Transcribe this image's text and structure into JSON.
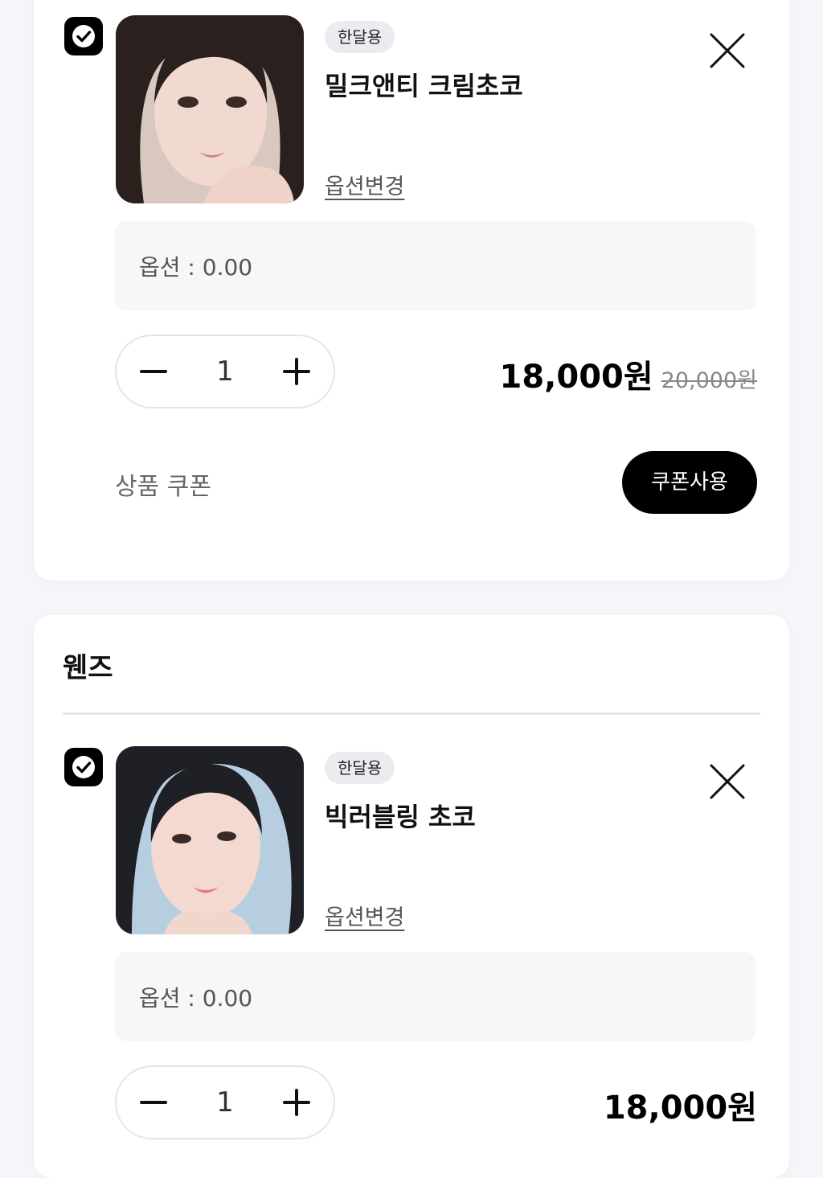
{
  "items": [
    {
      "badge": "한달용",
      "name": "밀크앤티 크림초코",
      "option_change": "옵션변경",
      "option_text": "옵션 : 0.00",
      "quantity": "1",
      "price": "18,000원",
      "original_price": "20,000원",
      "coupon_label": "상품 쿠폰",
      "coupon_button": "쿠폰사용",
      "checked": true
    },
    {
      "badge": "한달용",
      "name": "빅러블링 초코",
      "option_change": "옵션변경",
      "option_text": "옵션 : 0.00",
      "quantity": "1",
      "price": "18,000원",
      "checked": true
    }
  ],
  "section2": {
    "title": "웬즈"
  },
  "colors": {
    "accent": "#000000",
    "background": "#f4f6f9",
    "option_bg": "#f6f7f9"
  },
  "icons": {
    "check": "check-icon",
    "close": "close-icon",
    "minus": "minus-icon",
    "plus": "plus-icon"
  }
}
